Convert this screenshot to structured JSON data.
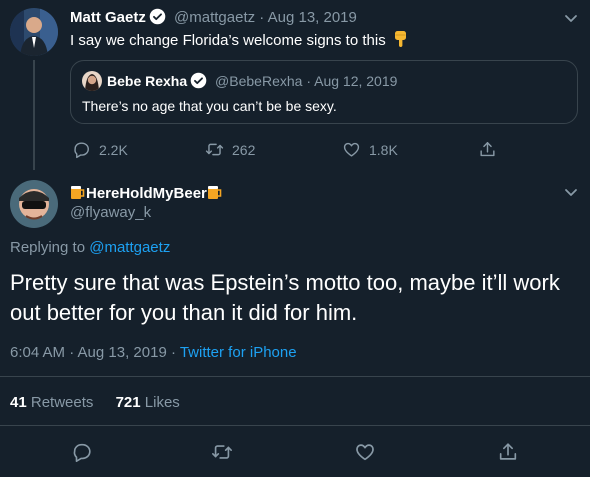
{
  "parent_tweet": {
    "display_name": "Matt Gaetz",
    "handle": "@mattgaetz",
    "date": "· Aug 13, 2019",
    "text": "I say we change Florida’s welcome signs to this",
    "emoji_icon": "pointing-down-hand-icon",
    "quoted": {
      "display_name": "Bebe Rexha",
      "handle": "@BebeRexha",
      "date": "· Aug 12, 2019",
      "text": "There’s no age that you can’t be be sexy."
    },
    "actions": {
      "replies": "2.2K",
      "retweets": "262",
      "likes": "1.8K"
    }
  },
  "main_tweet": {
    "display_name": "HereHoldMyBeer",
    "handle": "@flyaway_k",
    "replying_prefix": "Replying to",
    "replying_to": "@mattgaetz",
    "text": "Pretty sure that was Epstein’s motto too, maybe it’ll work out better for you than it did for him.",
    "timestamp": "6:04 AM · Aug 13, 2019 · ",
    "client": "Twitter for iPhone",
    "retweets_count": "41",
    "retweets_label": "Retweets",
    "likes_count": "721",
    "likes_label": "Likes"
  },
  "colors": {
    "background": "#15202b",
    "muted": "#8899a6",
    "accent": "#1da1f2",
    "border": "#38444d"
  }
}
